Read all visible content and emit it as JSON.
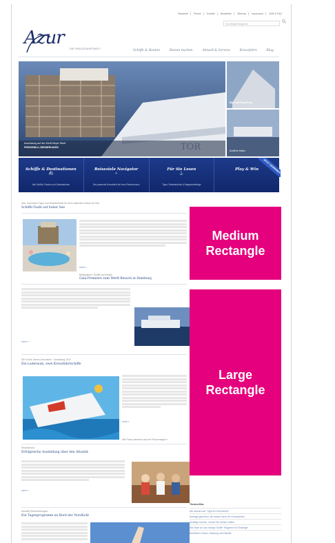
{
  "top_nav": [
    "Startseite",
    "Presse",
    "Kontakt",
    "Newsletter",
    "Sitemap",
    "Impressum",
    "AGB & FAQ"
  ],
  "search": {
    "placeholder": "Suchbegriff eingeben"
  },
  "logo": {
    "text": "Azur",
    "subtitle": "DIE KREUZFAHRTWELT"
  },
  "main_nav": [
    "Schiffe & Routen",
    "Reisen buchen",
    "Aktuell & Service",
    "Kreuzfahrt",
    "Blog"
  ],
  "hero": {
    "main_caption": "Ausrüstung auf der Werft Meyer Werft",
    "main_caption_sub": "PRESSEBILD, BREMERHAVEN",
    "thumb1_caption": "Blick auf Papenburg",
    "thumb2_caption": "Schiff im Hafen"
  },
  "blue_bar": [
    {
      "title": "Schiffe & Destinationen",
      "sub": "Alle Schiffe, Routen und Destinationen"
    },
    {
      "title": "Reiseziele Navigator",
      "sub": "Die passende Kreuzfahrt für Ihren Reisewunsch"
    },
    {
      "title": "Für Sie Lesen",
      "sub": "Tipps, Reiseberichte & Magazinbeiträge"
    },
    {
      "title": "Play & Win",
      "sub": ""
    }
  ],
  "ribbon": "JETZT GEWINNEN",
  "intro_small": "Neu: Kreuzfahrt-Tipps und Reiseberichte für Ihren nächsten Urlaub auf See",
  "article1": {
    "title": "Schiffe-Taufe auf hoher See",
    "caption": "Bildergalerie: Schiffe auf Reisen",
    "title2": "Gala-Premiere zum Werft-Besuch in Hamburg",
    "more": "mehr »"
  },
  "article2": {
    "more": "mehr »"
  },
  "article3": {
    "kicker": "Die Große Jahres-Kreuzfahrt · Vorstellung 2010",
    "title": "Ein Laderaum, zwei Kreuzfahrtschiffe",
    "more": "mehr »",
    "aside": "Alle Fotos stammen aus der Pressemappe »"
  },
  "article4": {
    "kicker": "Reisebericht",
    "title": "Erfolgreiche Ausbildung über den Atlantik",
    "more": "mehr »"
  },
  "article5": {
    "kicker": "Aktuelle Reisemeldungen",
    "title": "Ein Tagesprogramm an Bord der Nordlicht",
    "more": "mehr »"
  },
  "ads": {
    "medium_line1": "Medium",
    "medium_line2": "Rectangle",
    "large_line1": "Large",
    "large_line2": "Rectangle"
  },
  "sidebar_list": {
    "heading": "Themen-Box",
    "items": [
      "Wir räumen auf: Tipps für Kreuzfahrer",
      "Seetage genießen: die besten Ideen für Kreuzfahrten",
      "Ausflüge buchen: worauf Sie achten sollten",
      "Wie finde ich das richtige Schiff? Ratgeber für Einsteiger",
      "Bordleben: Essen, Kleidung und Etikette"
    ]
  },
  "colors": {
    "brand_blue": "#1b2d6a",
    "nav_blue": "#10276a",
    "ad_magenta": "#e5007d"
  }
}
